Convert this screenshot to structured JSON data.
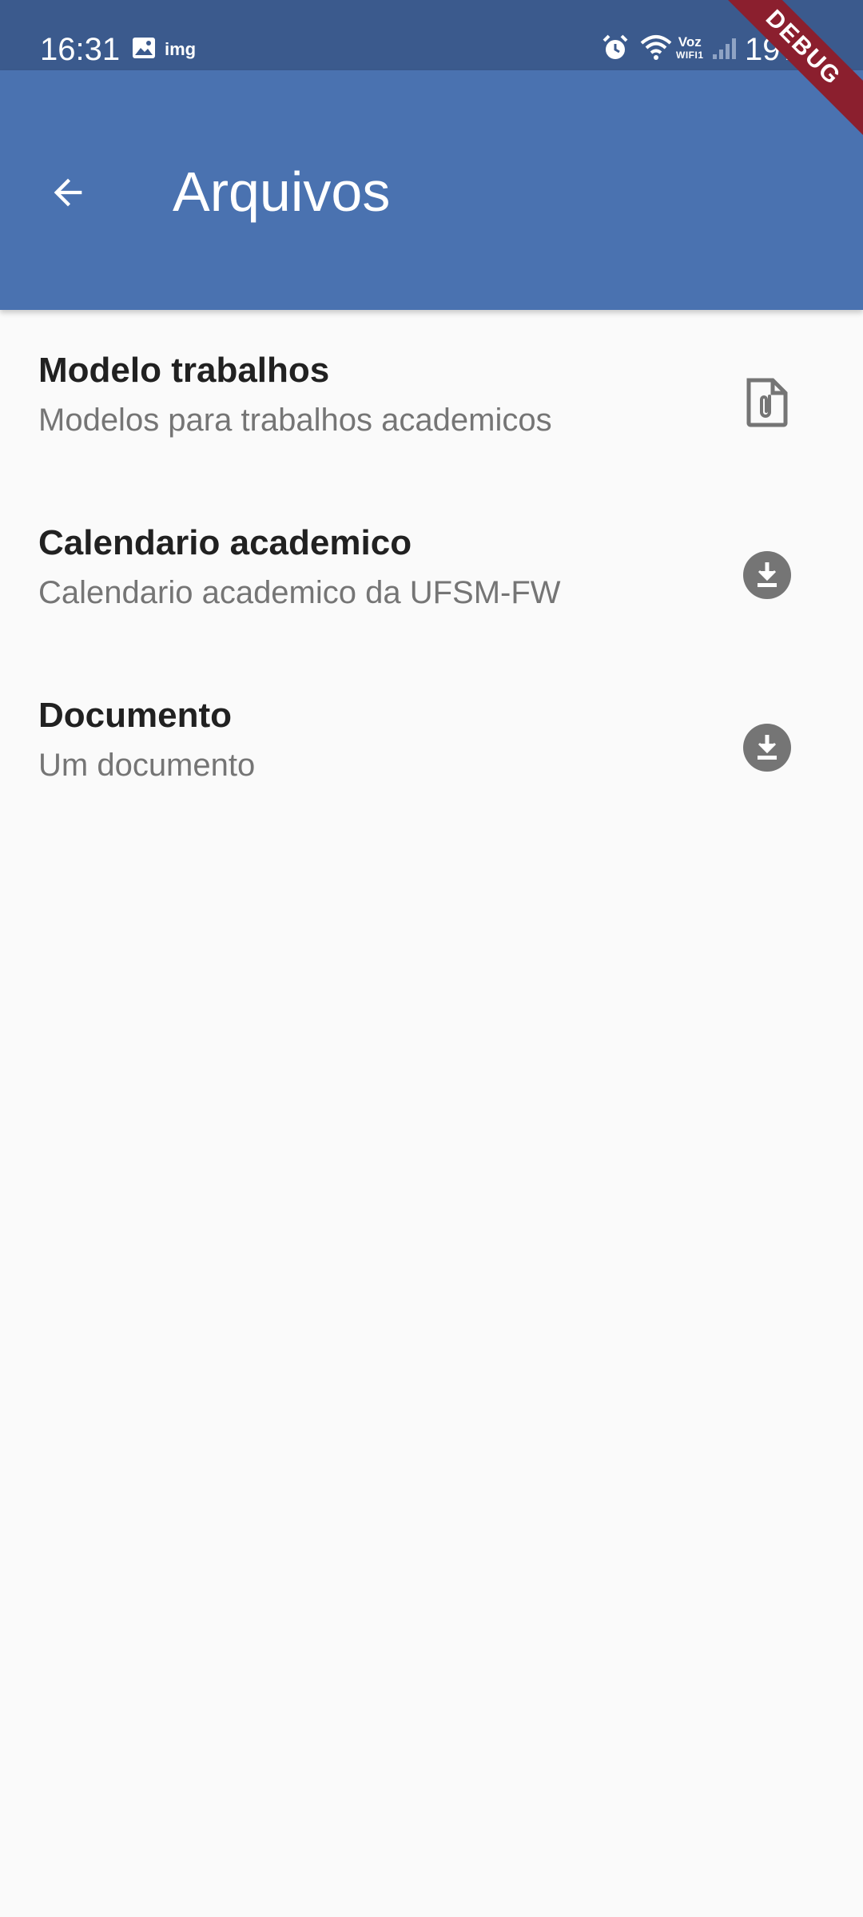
{
  "status_bar": {
    "time": "16:31",
    "notification_text": "img",
    "voz_label": "Voz",
    "wifi_label": "WIFI1",
    "battery": "19%",
    "icons": [
      "image-icon",
      "alarm-icon",
      "wifi-icon",
      "signal-icon"
    ]
  },
  "app_bar": {
    "title": "Arquivos",
    "back_icon": "arrow-back-icon",
    "color": "#4a72b0"
  },
  "items": [
    {
      "title": "Modelo trabalhos",
      "subtitle": "Modelos para trabalhos academicos",
      "icon": "file-attachment-icon"
    },
    {
      "title": "Calendario academico",
      "subtitle": "Calendario academico da UFSM-FW",
      "icon": "download-icon"
    },
    {
      "title": "Documento",
      "subtitle": "Um documento",
      "icon": "download-icon"
    }
  ],
  "debug_banner": "DEBUG",
  "colors": {
    "status_bar": "#3b5a8d",
    "background": "#fafafa",
    "title_text": "#212121",
    "subtitle_text": "#757575",
    "icon_gray": "#757575",
    "debug_banner": "#8b1f2e"
  }
}
